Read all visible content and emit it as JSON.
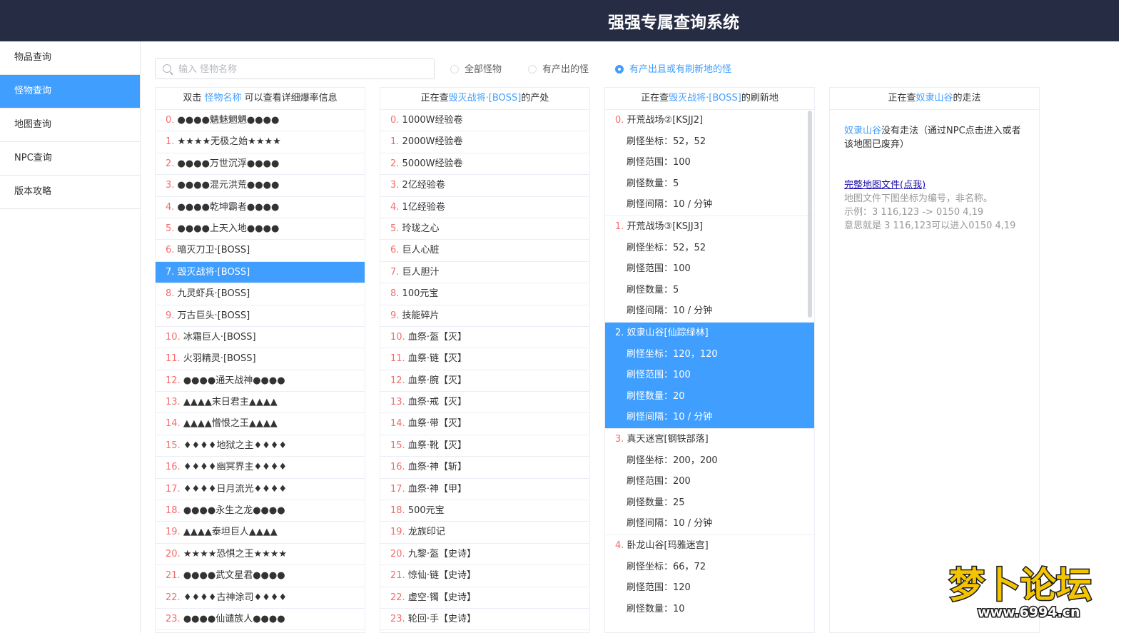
{
  "header": {
    "title": "强强专属查询系统"
  },
  "sidebar": {
    "items": [
      {
        "label": "物品查询",
        "active": false
      },
      {
        "label": "怪物查询",
        "active": true
      },
      {
        "label": "地图查询",
        "active": false
      },
      {
        "label": "NPC查询",
        "active": false
      },
      {
        "label": "版本攻略",
        "active": false
      }
    ]
  },
  "search": {
    "placeholder": "输入 怪物名称",
    "value": ""
  },
  "filters": {
    "options": [
      {
        "label": "全部怪物",
        "checked": false
      },
      {
        "label": "有产出的怪",
        "checked": false
      },
      {
        "label": "有产出且或有刷新地的怪",
        "checked": true
      }
    ]
  },
  "monsters": {
    "head_prefix": "双击 ",
    "head_highlight": "怪物名称",
    "head_suffix": " 可以查看详细爆率信息",
    "selected_index": 7,
    "items": [
      {
        "idx": "0.",
        "name": "●●●●魑魅魍魉●●●●"
      },
      {
        "idx": "1.",
        "name": "★★★★无极之始★★★★"
      },
      {
        "idx": "2.",
        "name": "●●●●万世沉浮●●●●"
      },
      {
        "idx": "3.",
        "name": "●●●●混元洪荒●●●●"
      },
      {
        "idx": "4.",
        "name": "●●●●乾坤霸者●●●●"
      },
      {
        "idx": "5.",
        "name": "●●●●上天入地●●●●"
      },
      {
        "idx": "6.",
        "name": "暗灭刀卫·[BOSS]"
      },
      {
        "idx": "7.",
        "name": "毁灭战将·[BOSS]"
      },
      {
        "idx": "8.",
        "name": "九灵虾兵·[BOSS]"
      },
      {
        "idx": "9.",
        "name": "万古巨头·[BOSS]"
      },
      {
        "idx": "10.",
        "name": "冰霜巨人·[BOSS]"
      },
      {
        "idx": "11.",
        "name": "火羽精灵·[BOSS]"
      },
      {
        "idx": "12.",
        "name": "●●●●通天战神●●●●"
      },
      {
        "idx": "13.",
        "name": "▲▲▲▲末日君主▲▲▲▲"
      },
      {
        "idx": "14.",
        "name": "▲▲▲▲憎恨之王▲▲▲▲"
      },
      {
        "idx": "15.",
        "name": "♦♦♦♦地狱之主♦♦♦♦"
      },
      {
        "idx": "16.",
        "name": "♦♦♦♦幽冥界主♦♦♦♦"
      },
      {
        "idx": "17.",
        "name": "♦♦♦♦日月流光♦♦♦♦"
      },
      {
        "idx": "18.",
        "name": "●●●●永生之龙●●●●"
      },
      {
        "idx": "19.",
        "name": "▲▲▲▲泰坦巨人▲▲▲▲"
      },
      {
        "idx": "20.",
        "name": "★★★★恐惧之王★★★★"
      },
      {
        "idx": "21.",
        "name": "●●●●武文星君●●●●"
      },
      {
        "idx": "22.",
        "name": "♦♦♦♦古神涂司♦♦♦♦"
      },
      {
        "idx": "23.",
        "name": "●●●●仙谴族人●●●●"
      }
    ]
  },
  "drops": {
    "head_prefix": "正在查",
    "head_highlight": "毁灭战将·[BOSS]",
    "head_suffix": "的产处",
    "items": [
      {
        "idx": "0.",
        "name": "1000W经验卷"
      },
      {
        "idx": "1.",
        "name": "2000W经验卷"
      },
      {
        "idx": "2.",
        "name": "5000W经验卷"
      },
      {
        "idx": "3.",
        "name": "2亿经验卷"
      },
      {
        "idx": "4.",
        "name": "1亿经验卷"
      },
      {
        "idx": "5.",
        "name": "玲珑之心"
      },
      {
        "idx": "6.",
        "name": "巨人心脏"
      },
      {
        "idx": "7.",
        "name": "巨人胆汁"
      },
      {
        "idx": "8.",
        "name": "100元宝"
      },
      {
        "idx": "9.",
        "name": "技能碎片"
      },
      {
        "idx": "10.",
        "name": "血祭·盔【灭】"
      },
      {
        "idx": "11.",
        "name": "血祭·链【灭】"
      },
      {
        "idx": "12.",
        "name": "血祭·腕【灭】"
      },
      {
        "idx": "13.",
        "name": "血祭·戒【灭】"
      },
      {
        "idx": "14.",
        "name": "血祭·带【灭】"
      },
      {
        "idx": "15.",
        "name": "血祭·靴【灭】"
      },
      {
        "idx": "16.",
        "name": "血祭·神【斩】"
      },
      {
        "idx": "17.",
        "name": "血祭·神【甲】"
      },
      {
        "idx": "18.",
        "name": "500元宝"
      },
      {
        "idx": "19.",
        "name": "龙族印记"
      },
      {
        "idx": "20.",
        "name": "九黎·盔【史诗】"
      },
      {
        "idx": "21.",
        "name": "惊仙·链【史诗】"
      },
      {
        "idx": "22.",
        "name": "虚空·镯【史诗】"
      },
      {
        "idx": "23.",
        "name": "轮回·手【史诗】"
      }
    ]
  },
  "spawns": {
    "head_prefix": "正在查",
    "head_highlight": "毁灭战将·[BOSS]",
    "head_suffix": "的刷新地",
    "labels": {
      "coord": "刷怪坐标：",
      "range": "刷怪范围：",
      "count": "刷怪数量：",
      "interval": "刷怪间隔："
    },
    "selected_index": 2,
    "items": [
      {
        "idx": "0.",
        "name": "开荒战场②[KSJJ2]",
        "coord": "52，52",
        "range": "100",
        "count": "5",
        "interval": "10 / 分钟"
      },
      {
        "idx": "1.",
        "name": "开荒战场③[KSJJ3]",
        "coord": "52，52",
        "range": "100",
        "count": "5",
        "interval": "10 / 分钟"
      },
      {
        "idx": "2.",
        "name": "奴隶山谷[仙踪绿林]",
        "coord": "120，120",
        "range": "100",
        "count": "20",
        "interval": "10 / 分钟"
      },
      {
        "idx": "3.",
        "name": "真天迷宫[钢铁部落]",
        "coord": "200，200",
        "range": "200",
        "count": "25",
        "interval": "10 / 分钟"
      },
      {
        "idx": "4.",
        "name": "卧龙山谷[玛雅迷宫]",
        "coord": "66，72",
        "range": "120",
        "count": "10",
        "interval": ""
      }
    ]
  },
  "route": {
    "head_prefix": "正在查",
    "head_highlight": "奴隶山谷",
    "head_suffix": "的走法",
    "map_name": "奴隶山谷",
    "message": "没有走法（通过NPC点击进入或者该地图已废弃）",
    "link": "完整地图文件(点我)",
    "note1": "地图文件下图坐标为编号，非名称。",
    "note2": "示例：3 116,123 -> 0150 4,19",
    "note3": "意思就是 3 116,123可以进入0150 4,19"
  },
  "watermark": {
    "text_main": "梦卜论坛",
    "text_url": "www.6994.cn"
  },
  "colors": {
    "accent": "#409eff",
    "index": "#f56c6c",
    "header_bg": "#262c44"
  }
}
